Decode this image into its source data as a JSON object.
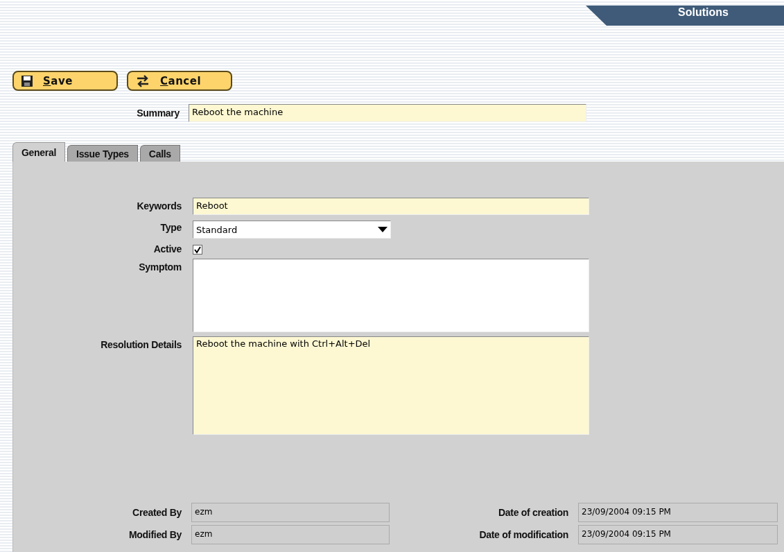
{
  "header": {
    "title": "Solutions"
  },
  "toolbar": [
    {
      "kind": "save",
      "label": "Save"
    },
    {
      "kind": "cancel",
      "label": "Cancel"
    }
  ],
  "summary": {
    "label": "Summary",
    "value": "Reboot the machine"
  },
  "tabs": [
    {
      "label": "General",
      "selected": true
    },
    {
      "label": "Issue Types",
      "selected": false
    },
    {
      "label": "Calls",
      "selected": false
    }
  ],
  "general": {
    "keywords": {
      "label": "Keywords",
      "value": "Reboot"
    },
    "type": {
      "label": "Type",
      "value": "Standard"
    },
    "active": {
      "label": "Active",
      "checked": true
    },
    "symptom": {
      "label": "Symptom"
    },
    "resolution": {
      "label": "Resolution Details",
      "value": "Reboot the machine with Ctrl+Alt+Del"
    }
  },
  "audit": [
    {
      "label": "Created By",
      "value": "ezm"
    },
    {
      "label": "Date of creation",
      "value": "23/09/2004 09:15 PM"
    },
    {
      "label": "Modified By",
      "value": "ezm"
    },
    {
      "label": "Date of modification",
      "value": "23/09/2004 09:15 PM"
    }
  ]
}
